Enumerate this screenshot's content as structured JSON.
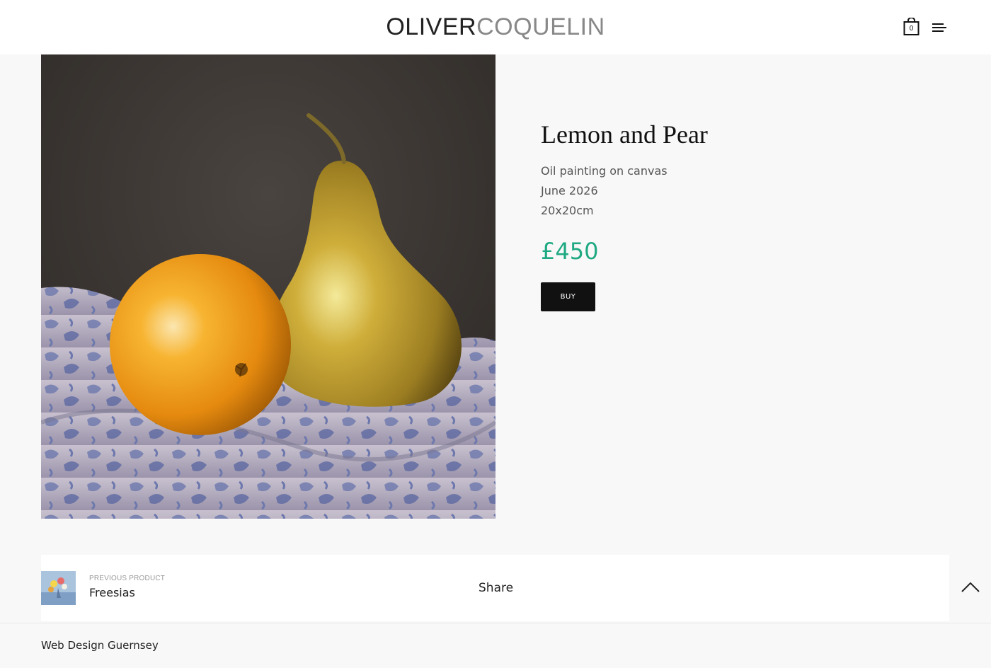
{
  "header": {
    "logo_first": "OLIVER",
    "logo_last": "COQUELIN",
    "cart_count": "0",
    "cart_icon": "shopping-bag-icon",
    "menu_icon": "hamburger-menu-icon"
  },
  "product": {
    "title": "Lemon and Pear",
    "description": [
      "Oil painting on canvas",
      "June 2026",
      "20x20cm"
    ],
    "price": "£450",
    "buy_label": "BUY",
    "image_subject": "still life painting of an orange and a pear on blue and white patterned cloth"
  },
  "navigation": {
    "prev_label": "PREVIOUS PRODUCT",
    "prev_name": "Freesias",
    "share_label": "Share",
    "back_to_top_icon": "chevron-up-icon"
  },
  "footer": {
    "link": "Web Design Guernsey"
  },
  "colors": {
    "accent_price": "#1fa982",
    "button_bg": "#111111",
    "page_bg": "#f8f8f8"
  }
}
